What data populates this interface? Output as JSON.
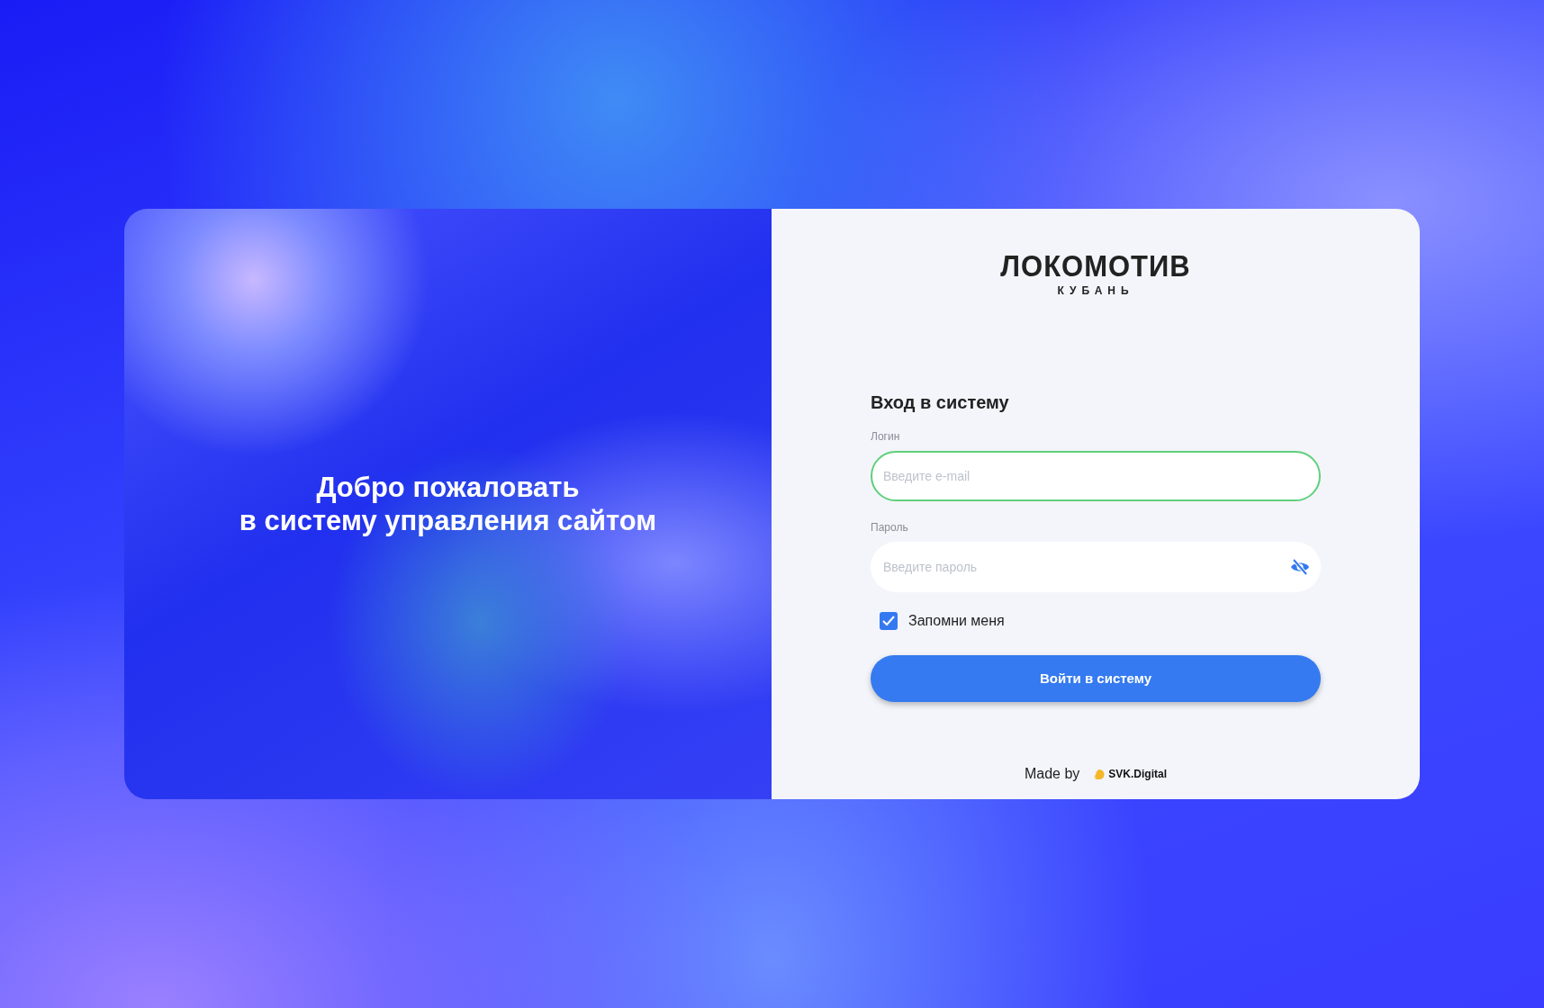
{
  "welcome": {
    "lines": [
      "Добро пожаловать",
      "в систему управления сайтом"
    ]
  },
  "logo": {
    "title": "ЛОКОМОТИВ",
    "subtitle": "КУБАНЬ"
  },
  "form": {
    "title": "Вход в систему",
    "fields": [
      {
        "kind": "email",
        "label": "Логин",
        "placeholder": "Введите e-mail",
        "focused": true
      },
      {
        "kind": "password",
        "label": "Пароль",
        "placeholder": "Введите пароль",
        "focused": false
      }
    ],
    "remember": {
      "label": "Запомни меня",
      "checked": true
    },
    "submit": "Войти в систему"
  },
  "footer": {
    "made_by": "Made by",
    "brand": "SVK.Digital"
  }
}
